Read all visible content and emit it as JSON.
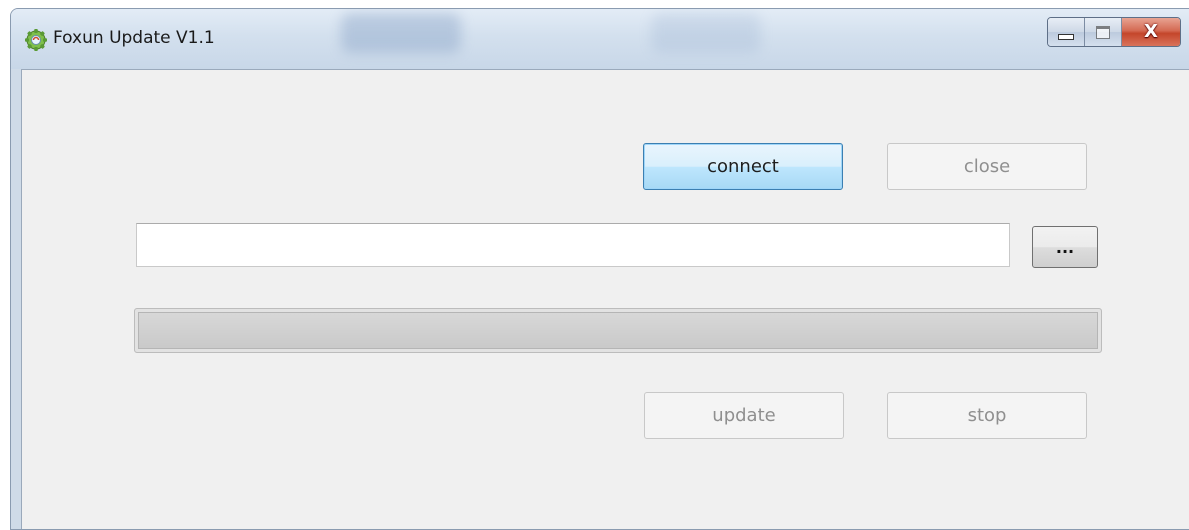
{
  "window": {
    "title": "Foxun Update V1.1",
    "icon": "gear-app-icon"
  },
  "caption_buttons": {
    "minimize_icon": "minimize-icon",
    "maximize_icon": "maximize-icon",
    "close_icon": "close-icon",
    "close_glyph": "X"
  },
  "buttons": {
    "connect": "connect",
    "close": "close",
    "browse": "...",
    "update": "update",
    "stop": "stop"
  },
  "file_path": {
    "value": "",
    "placeholder": ""
  },
  "progress": {
    "value": 0
  },
  "colors": {
    "client_background": "#f0f0f0",
    "default_button_border": "#3c7fb1",
    "close_button_red": "#c4462b"
  }
}
